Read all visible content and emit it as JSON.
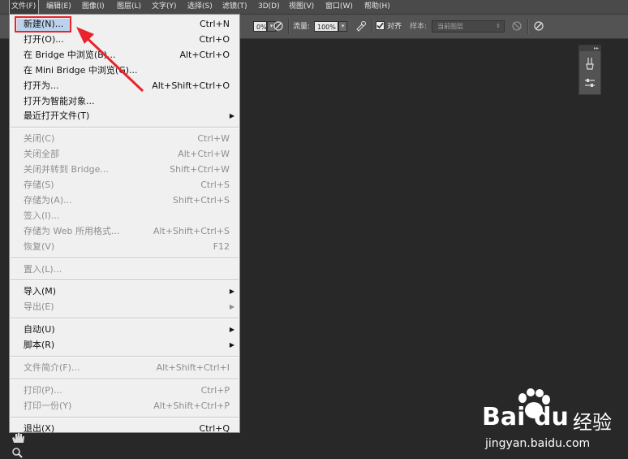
{
  "menubar": {
    "items": [
      "文件(F)",
      "编辑(E)",
      "图像(I)",
      "图层(L)",
      "文字(Y)",
      "选择(S)",
      "滤镜(T)",
      "3D(D)",
      "视图(V)",
      "窗口(W)",
      "帮助(H)"
    ]
  },
  "options_bar": {
    "opacity_value": "0%",
    "flow_label": "流量:",
    "flow_value": "100%",
    "align_label": "对齐",
    "sample_label": "样本:",
    "sample_value": "当前图层"
  },
  "file_menu": {
    "groups": [
      [
        {
          "label": "新建(N)...",
          "shortcut": "Ctrl+N",
          "enabled": true,
          "submenu": false
        },
        {
          "label": "打开(O)...",
          "shortcut": "Ctrl+O",
          "enabled": true,
          "submenu": false
        },
        {
          "label": "在 Bridge 中浏览(B)...",
          "shortcut": "Alt+Ctrl+O",
          "enabled": true,
          "submenu": false
        },
        {
          "label": "在 Mini Bridge 中浏览(G)...",
          "shortcut": "",
          "enabled": true,
          "submenu": false
        },
        {
          "label": "打开为...",
          "shortcut": "Alt+Shift+Ctrl+O",
          "enabled": true,
          "submenu": false
        },
        {
          "label": "打开为智能对象...",
          "shortcut": "",
          "enabled": true,
          "submenu": false
        },
        {
          "label": "最近打开文件(T)",
          "shortcut": "",
          "enabled": true,
          "submenu": true
        }
      ],
      [
        {
          "label": "关闭(C)",
          "shortcut": "Ctrl+W",
          "enabled": false,
          "submenu": false
        },
        {
          "label": "关闭全部",
          "shortcut": "Alt+Ctrl+W",
          "enabled": false,
          "submenu": false
        },
        {
          "label": "关闭并转到 Bridge...",
          "shortcut": "Shift+Ctrl+W",
          "enabled": false,
          "submenu": false
        },
        {
          "label": "存储(S)",
          "shortcut": "Ctrl+S",
          "enabled": false,
          "submenu": false
        },
        {
          "label": "存储为(A)...",
          "shortcut": "Shift+Ctrl+S",
          "enabled": false,
          "submenu": false
        },
        {
          "label": "签入(I)...",
          "shortcut": "",
          "enabled": false,
          "submenu": false
        },
        {
          "label": "存储为 Web 所用格式...",
          "shortcut": "Alt+Shift+Ctrl+S",
          "enabled": false,
          "submenu": false
        },
        {
          "label": "恢复(V)",
          "shortcut": "F12",
          "enabled": false,
          "submenu": false
        }
      ],
      [
        {
          "label": "置入(L)...",
          "shortcut": "",
          "enabled": false,
          "submenu": false
        }
      ],
      [
        {
          "label": "导入(M)",
          "shortcut": "",
          "enabled": true,
          "submenu": true
        },
        {
          "label": "导出(E)",
          "shortcut": "",
          "enabled": false,
          "submenu": true
        }
      ],
      [
        {
          "label": "自动(U)",
          "shortcut": "",
          "enabled": true,
          "submenu": true
        },
        {
          "label": "脚本(R)",
          "shortcut": "",
          "enabled": true,
          "submenu": true
        }
      ],
      [
        {
          "label": "文件简介(F)...",
          "shortcut": "Alt+Shift+Ctrl+I",
          "enabled": false,
          "submenu": false
        }
      ],
      [
        {
          "label": "打印(P)...",
          "shortcut": "Ctrl+P",
          "enabled": false,
          "submenu": false
        },
        {
          "label": "打印一份(Y)",
          "shortcut": "Alt+Shift+Ctrl+P",
          "enabled": false,
          "submenu": false
        }
      ],
      [
        {
          "label": "退出(X)",
          "shortcut": "Ctrl+Q",
          "enabled": true,
          "submenu": false
        }
      ]
    ]
  },
  "watermark": {
    "brand": "Bai",
    "brand_suffix": "du",
    "product": "经验",
    "url": "jingyan.baidu.com"
  },
  "colors": {
    "highlight_box": "#e8232c",
    "arrow": "#e8232c"
  }
}
